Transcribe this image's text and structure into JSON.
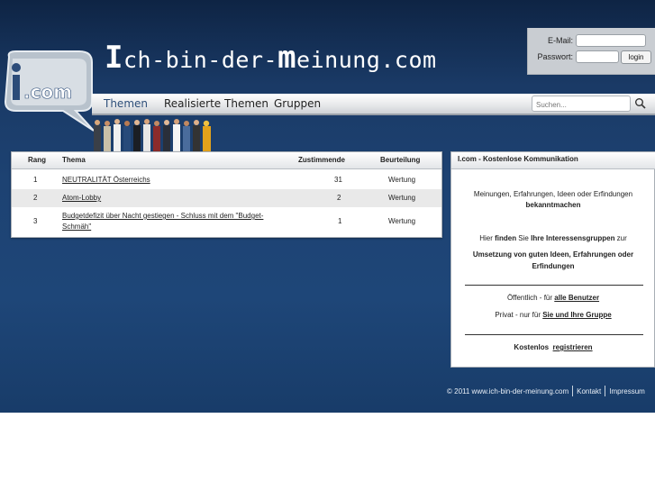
{
  "header": {
    "logo_text": ".com",
    "site_title_prefix": "ch-bin-der-",
    "site_title_big": "m",
    "site_title_suffix": "einung.com"
  },
  "login": {
    "email_label": "E-Mail:",
    "password_label": "Passwort:",
    "email_value": "",
    "password_value": "",
    "login_button": "login"
  },
  "nav": {
    "items": [
      {
        "label": "Themen"
      },
      {
        "label": "Realisierte Themen"
      },
      {
        "label": "Gruppen"
      }
    ],
    "search_placeholder": "Suchen..."
  },
  "table": {
    "headers": {
      "rank": "Rang",
      "topic": "Thema",
      "agree": "Zustimmende",
      "rating": "Beurteilung"
    },
    "rows": [
      {
        "rank": "1",
        "topic": "NEUTRALITÄT Österreichs",
        "agree": "31",
        "rating": "Wertung"
      },
      {
        "rank": "2",
        "topic": "Atom-Lobby",
        "agree": "2",
        "rating": "Wertung"
      },
      {
        "rank": "3",
        "topic": "Budgetdefizit über Nacht gestiegen - Schluss mit dem \"Budget-Schmäh\"",
        "agree": "1",
        "rating": "Wertung"
      }
    ]
  },
  "info": {
    "title": "I.com - Kostenlose Kommunikation",
    "line1": "Meinungen, Erfahrungen, Ideen oder Erfindungen",
    "line1b": "bekanntmachen",
    "line2a": "Hier ",
    "line2b": "finden",
    "line2c": " Sie ",
    "line2d": "Ihre Interessensgruppen",
    "line2e": " zur",
    "line3": "Umsetzung von guten Ideen, Erfahrungen oder Erfindungen",
    "public_prefix": "Öffentlich - für ",
    "public_link": "alle Benutzer",
    "private_prefix": "Privat - nur für ",
    "private_link": "Sie und Ihre Gruppe",
    "free_label": "Kostenlos",
    "register_link": "registrieren"
  },
  "footer": {
    "copyright": "© 2011 www.ich-bin-der-meinung.com",
    "contact": "Kontakt",
    "imprint": "Impressum"
  },
  "colors": {
    "background_top": "#0e2444",
    "background_bottom": "#183c69",
    "row_alt": "#e9e9e9"
  }
}
